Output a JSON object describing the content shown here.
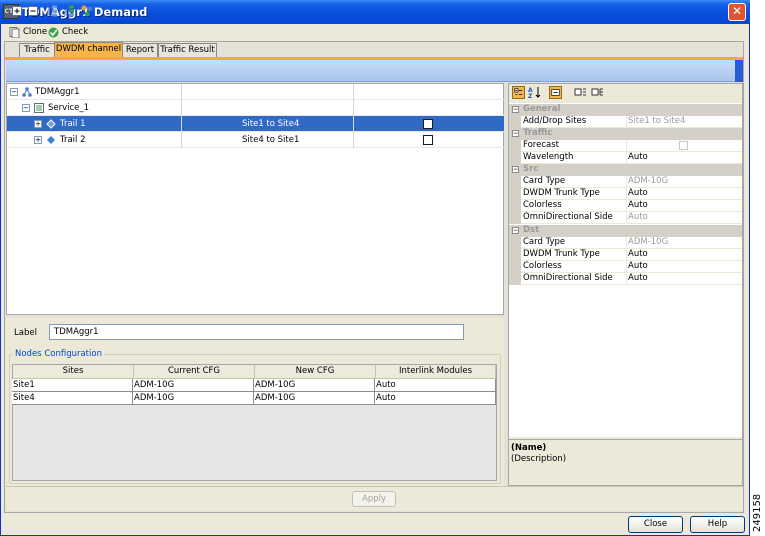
{
  "window": {
    "title": "TDMAggr1 Demand",
    "app_icon": "cisco-ctp-icon",
    "close_glyph": "✕"
  },
  "toolbar": {
    "clone_label": "Clone",
    "check_label": "Check"
  },
  "tabs": [
    {
      "label": "Traffic"
    },
    {
      "label": "DWDM channel",
      "active": true
    },
    {
      "label": "Report"
    },
    {
      "label": "Traffic Result"
    }
  ],
  "tree": {
    "root": {
      "label": "TDMAggr1"
    },
    "service": {
      "label": "Service_1"
    },
    "trails": [
      {
        "label": "Trail 1",
        "sites": "Site1 to Site4",
        "checked": false,
        "selected": true
      },
      {
        "label": "Trail 2",
        "sites": "Site4 to Site1",
        "checked": false,
        "selected": false
      }
    ]
  },
  "label_field": {
    "caption": "Label",
    "value": "TDMAggr1"
  },
  "nodes_config": {
    "title": "Nodes Configuration",
    "columns": [
      "Sites",
      "Current CFG",
      "New CFG",
      "Interlink Modules"
    ],
    "rows": [
      [
        "Site1",
        "ADM-10G",
        "ADM-10G",
        "Auto"
      ],
      [
        "Site4",
        "ADM-10G",
        "ADM-10G",
        "Auto"
      ]
    ]
  },
  "apply_label": "Apply",
  "properties": {
    "general": {
      "label": "General",
      "add_drop_name": "Add/Drop Sites",
      "add_drop_value": "Site1 to Site4"
    },
    "traffic": {
      "label": "Traffic",
      "forecast_name": "Forecast",
      "wavelength_name": "Wavelength",
      "wavelength_value": "Auto"
    },
    "src": {
      "label": "Src",
      "card_type_name": "Card Type",
      "card_type_value": "ADM-10G",
      "trunk_name": "DWDM Trunk Type",
      "trunk_value": "Auto",
      "colorless_name": "Colorless",
      "colorless_value": "Auto",
      "omni_name": "OmniDirectional Side",
      "omni_value": "Auto"
    },
    "dst": {
      "label": "Dst",
      "card_type_name": "Card Type",
      "card_type_value": "ADM-10G",
      "trunk_name": "DWDM Trunk Type",
      "trunk_value": "Auto",
      "colorless_name": "Colorless",
      "colorless_value": "Auto",
      "omni_name": "OmniDirectional Side",
      "omni_value": "Auto"
    },
    "description": {
      "name": "(Name)",
      "text": "(Description)"
    }
  },
  "buttons": {
    "close_label": "Close",
    "help_label": "Help"
  },
  "figure_id": "249158"
}
